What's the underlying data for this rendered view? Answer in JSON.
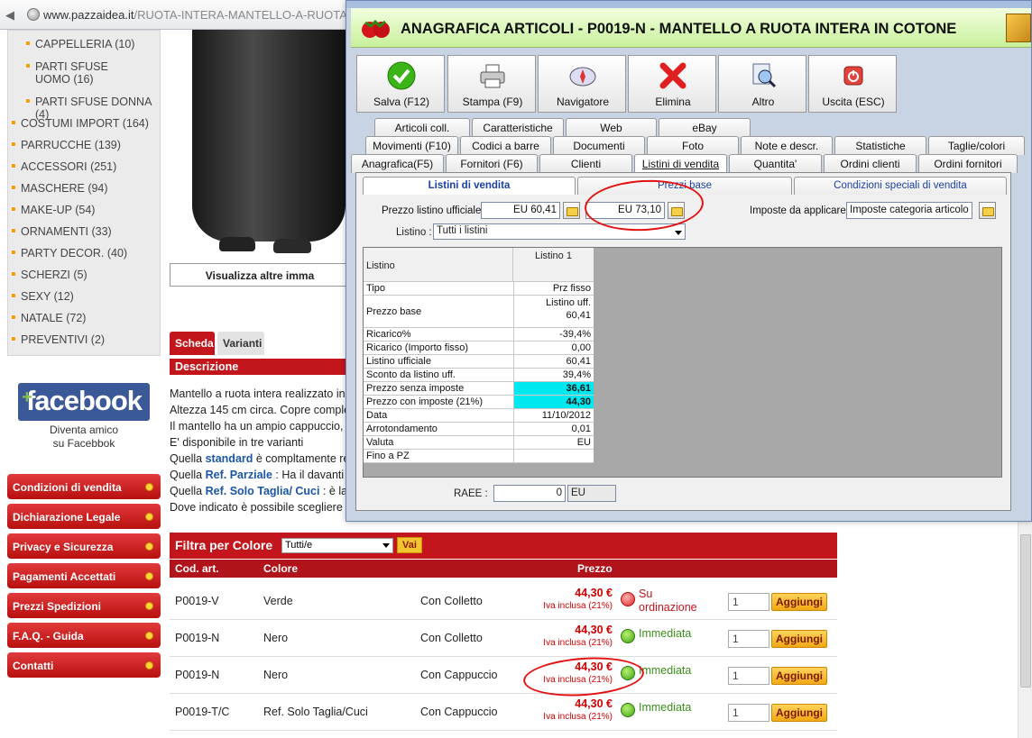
{
  "browser": {
    "url_host": "www.pazzaidea.it",
    "url_path": "/RUOTA-INTERA-MANTELLO-A-RUOTA-COT"
  },
  "sidebar": {
    "categories": [
      {
        "label": "CAPPELLERIA (10)",
        "sub": true
      },
      {
        "label": "PARTI SFUSE UOMO (16)",
        "sub": true
      },
      {
        "label": "PARTI SFUSE DONNA (4)",
        "sub": true
      },
      {
        "label": "COSTUMI IMPORT (164)"
      },
      {
        "label": "PARRUCCHE (139)"
      },
      {
        "label": "ACCESSORI (251)"
      },
      {
        "label": "MASCHERE (94)"
      },
      {
        "label": "MAKE-UP (54)"
      },
      {
        "label": "ORNAMENTI (33)"
      },
      {
        "label": "PARTY DECOR. (40)"
      },
      {
        "label": "SCHERZI (5)"
      },
      {
        "label": "SEXY (12)"
      },
      {
        "label": "NATALE (72)"
      },
      {
        "label": "PREVENTIVI (2)"
      }
    ],
    "facebook": {
      "logo": "facebook",
      "line1": "Diventa amico",
      "line2": "su Facebbok"
    },
    "links": [
      "Condizioni di vendita",
      "Dichiarazione Legale",
      "Privacy e Sicurezza",
      "Pagamenti Accettati",
      "Prezzi Spedizioni",
      "F.A.Q. - Guida",
      "Contatti"
    ]
  },
  "product": {
    "view_more": "Visualizza altre imma",
    "tabs": [
      "Scheda",
      "Varianti"
    ],
    "description_title": "Descrizione",
    "description_lines": [
      {
        "pre": "Mantello a ruota intera realizzato in c",
        "bold": "",
        "post": ""
      },
      {
        "pre": "Altezza 145 cm circa. Copre comple",
        "bold": "",
        "post": ""
      },
      {
        "pre": "Il mantello ha un ampio cappuccio,",
        "bold": "",
        "post": ""
      },
      {
        "pre": "E' disponibile in tre varianti",
        "bold": "",
        "post": ""
      },
      {
        "pre": "Quella ",
        "bold": "standard",
        "post": " è compltamente re"
      },
      {
        "pre": "Quella ",
        "bold": "Ref. Parziale",
        "post": " : Ha il davanti e"
      },
      {
        "pre": "Quella ",
        "bold": "Ref. Solo Taglia/ Cuci",
        "post": " : è la v"
      },
      {
        "pre": "Dove indicato è possibile scegliere",
        "bold": "",
        "post": ""
      }
    ]
  },
  "filter": {
    "title": "Filtra per Colore",
    "selected": "Tutti/e",
    "go": "Vai",
    "headers": [
      "Cod. art.",
      "Colore",
      "Prezzo"
    ]
  },
  "variants": [
    {
      "code": "P0019-V",
      "color": "Verde",
      "type": "Con Colletto",
      "price": "44,30 €",
      "iva": "Iva inclusa (21%)",
      "availability": "Su ordinazione",
      "status": "red",
      "qty": "1",
      "add": "Aggiungi"
    },
    {
      "code": "P0019-N",
      "color": "Nero",
      "type": "Con Colletto",
      "price": "44,30 €",
      "iva": "Iva inclusa (21%)",
      "availability": "Immediata",
      "status": "green",
      "qty": "1",
      "add": "Aggiungi"
    },
    {
      "code": "P0019-N",
      "color": "Nero",
      "type": "Con Cappuccio",
      "price": "44,30 €",
      "iva": "Iva inclusa (21%)",
      "availability": "Immediata",
      "status": "green",
      "qty": "1",
      "add": "Aggiungi"
    },
    {
      "code": "P0019-T/C",
      "color": "Ref. Solo Taglia/Cuci",
      "type": "Con Cappuccio",
      "price": "44,30 €",
      "iva": "Iva inclusa (21%)",
      "availability": "Immediata",
      "status": "green",
      "qty": "1",
      "add": "Aggiungi"
    }
  ],
  "app": {
    "window_title": "ANAGRAFICA ARTICOLI - P0019-N - MANTELLO A RUOTA INTERA IN COTONE",
    "header_title": "ANAGRAFICA ARTICOLI - P0019-N - MANTELLO A RUOTA INTERA IN COTONE",
    "toolbar": [
      {
        "label": "Salva (F12)",
        "icon": "check-icon"
      },
      {
        "label": "Stampa (F9)",
        "icon": "printer-icon"
      },
      {
        "label": "Navigatore",
        "icon": "compass-icon"
      },
      {
        "label": "Elimina",
        "icon": "delete-x-icon"
      },
      {
        "label": "Altro",
        "icon": "magnifier-icon"
      },
      {
        "label": "Uscita (ESC)",
        "icon": "power-icon"
      }
    ],
    "tabs_row1": [
      "Articoli coll.",
      "Caratteristiche",
      "Web",
      "eBay"
    ],
    "tabs_row2": [
      "Movimenti (F10)",
      "Codici a barre",
      "Documenti",
      "Foto",
      "Note e descr.",
      "Statistiche",
      "Taglie/colori"
    ],
    "tabs_row3": [
      "Anagrafica(F5)",
      "Fornitori (F6)",
      "Clienti",
      "Listini di vendita",
      "Quantita'",
      "Ordini clienti",
      "Ordini fornitori"
    ],
    "active_tab": "Listini di vendita",
    "subtabs": [
      "Listini di vendita",
      "Prezzi base",
      "Condizioni speciali di vendita"
    ],
    "price_list_label": "Prezzo listino ufficiale :",
    "price_list_value": "EU 60,41",
    "price_list_value2": "EU 73,10",
    "taxes_label": "Imposte da applicare :",
    "taxes_value": "Imposte categoria articolo",
    "listino_label": "Listino :",
    "listino_value": "Tutti i listini",
    "grid": {
      "header_left": "Listino",
      "header_right": "Listino 1",
      "rows": [
        {
          "k": "Tipo",
          "v": "Prz fisso"
        },
        {
          "k": "Prezzo base",
          "v": "Listino uff.",
          "v2": "60,41"
        },
        {
          "k": "Ricarico%",
          "v": "-39,4%"
        },
        {
          "k": "Ricarico (Importo fisso)",
          "v": "0,00"
        },
        {
          "k": "Listino ufficiale",
          "v": "60,41"
        },
        {
          "k": "Sconto da listino uff.",
          "v": "39,4%"
        },
        {
          "k": "Prezzo senza imposte",
          "v": "36,61",
          "hl": true
        },
        {
          "k": "Prezzo con imposte (21%)",
          "v": "44,30",
          "hl": true
        },
        {
          "k": "Data",
          "v": "11/10/2012"
        },
        {
          "k": "Arrotondamento",
          "v": "0,01"
        },
        {
          "k": "Valuta",
          "v": "EU"
        },
        {
          "k": "Fino a PZ",
          "v": ""
        }
      ]
    },
    "raee_label": "RAEE :",
    "raee_value": "0",
    "raee_currency": "EU"
  },
  "colors": {
    "brand_red": "#c3161c",
    "header_green": "#c7f09a",
    "highlight_cyan": "#00e8ef",
    "annotation_red": "#e41111"
  }
}
